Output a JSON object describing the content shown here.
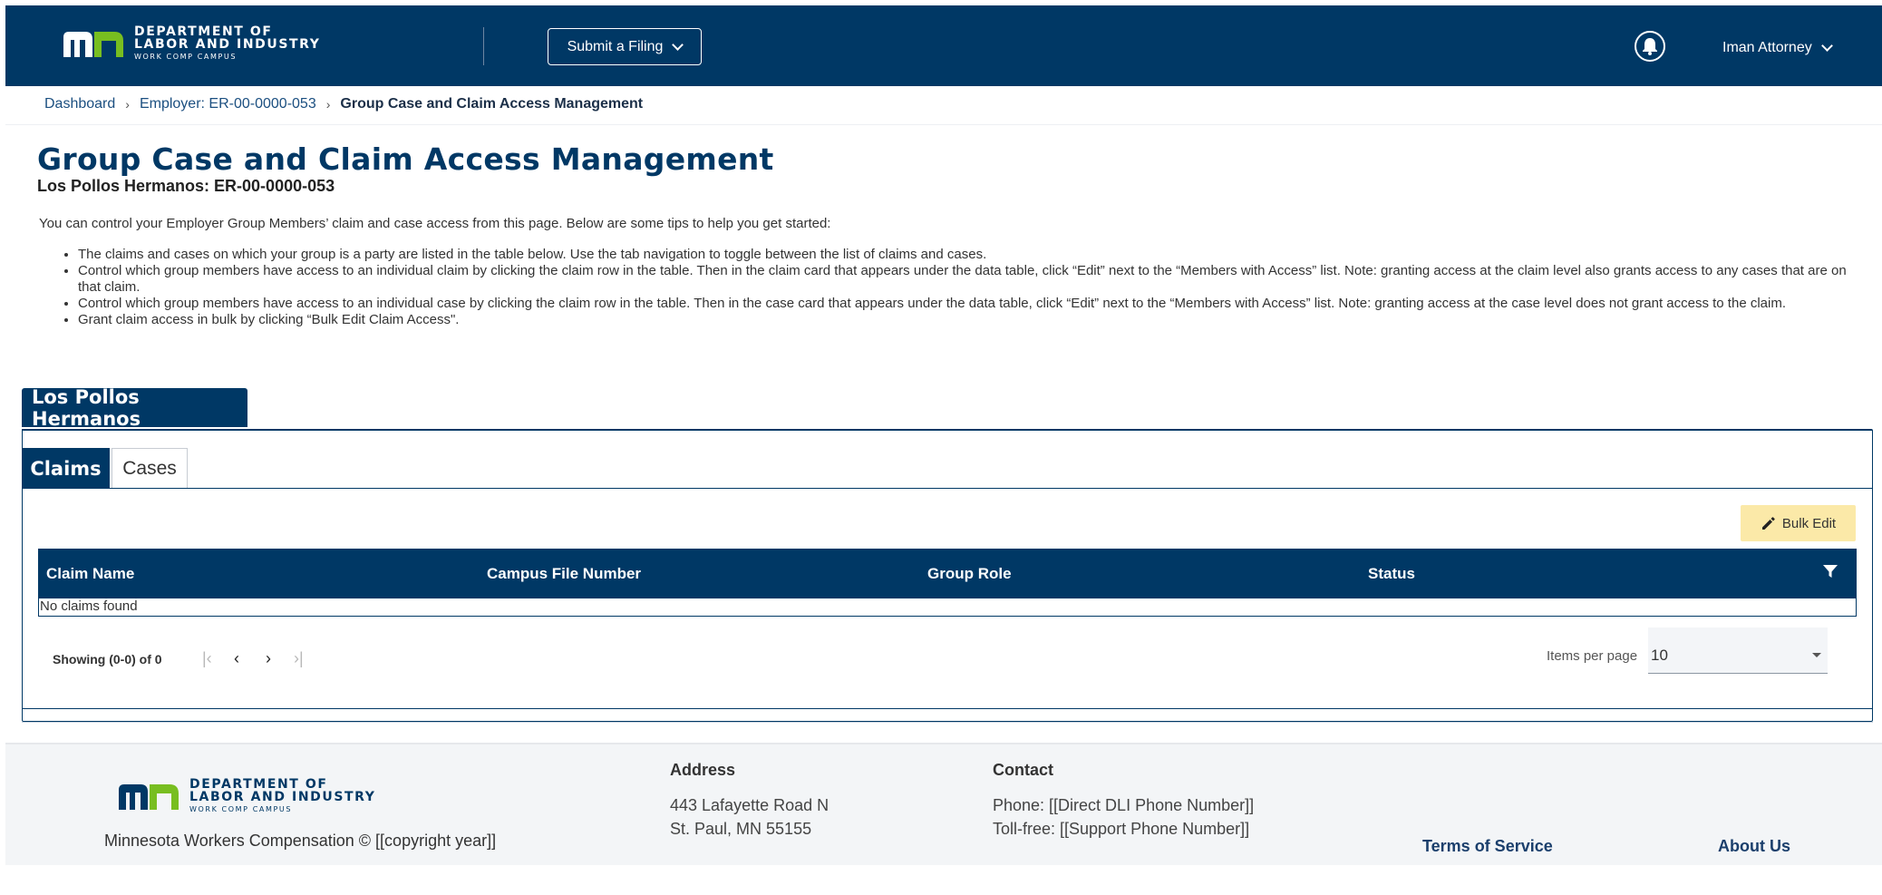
{
  "header": {
    "logo": {
      "line1": "DEPARTMENT OF",
      "line2": "LABOR AND INDUSTRY",
      "line3": "WORK COMP CAMPUS",
      "mark": "mn"
    },
    "submit_label": "Submit a Filing",
    "user_name": "Iman Attorney",
    "colors": {
      "navy": "#003865",
      "green": "#78be20"
    }
  },
  "breadcrumb": {
    "items": [
      "Dashboard",
      "Employer: ER-00-0000-053"
    ],
    "current": "Group Case and Claim Access Management"
  },
  "page": {
    "title": "Group Case and Claim Access Management",
    "subtitle": "Los Pollos Hermanos: ER-00-0000-053",
    "intro": "You can control your Employer Group Members’ claim and case access from this page. Below are some tips to help you get started:",
    "tips": [
      "The claims and cases on which your group is a party are listed in the table below. Use the tab navigation to toggle between the list of claims and cases.",
      "Control which group members have access to an individual claim by clicking the claim row in the table. Then in the claim card that appears under the data table, click “Edit” next to the “Members with Access” list. Note: granting access at the claim level also grants access to any cases that are on that claim.",
      "Control which group members have access to an individual case by clicking the claim row in the table. Then in the case card that appears under the data table, click “Edit” next to the “Members with Access” list. Note: granting access at the case level does not grant access to the claim.",
      "Grant claim access in bulk by clicking “Bulk Edit Claim Access\"."
    ]
  },
  "group": {
    "name": "Los Pollos Hermanos",
    "tabs": [
      "Claims",
      "Cases"
    ],
    "bulk_edit_label": "Bulk Edit",
    "table": {
      "columns": [
        "Claim Name",
        "Campus File Number",
        "Group Role",
        "Status"
      ],
      "empty_message": "No claims found"
    },
    "pagination": {
      "showing": "Showing (0-0) of 0",
      "items_per_page_label": "Items per page",
      "items_per_page_value": "10"
    }
  },
  "footer": {
    "copyright": "Minnesota Workers Compensation © [[copyright year]]",
    "address_heading": "Address",
    "address_lines": [
      "443 Lafayette Road N",
      "St. Paul, MN 55155"
    ],
    "contact_heading": "Contact",
    "contact_lines": [
      "Phone: [[Direct DLI Phone Number]]",
      "Toll-free: [[Support Phone Number]]"
    ],
    "links": [
      "Terms of Service",
      "About Us"
    ]
  }
}
